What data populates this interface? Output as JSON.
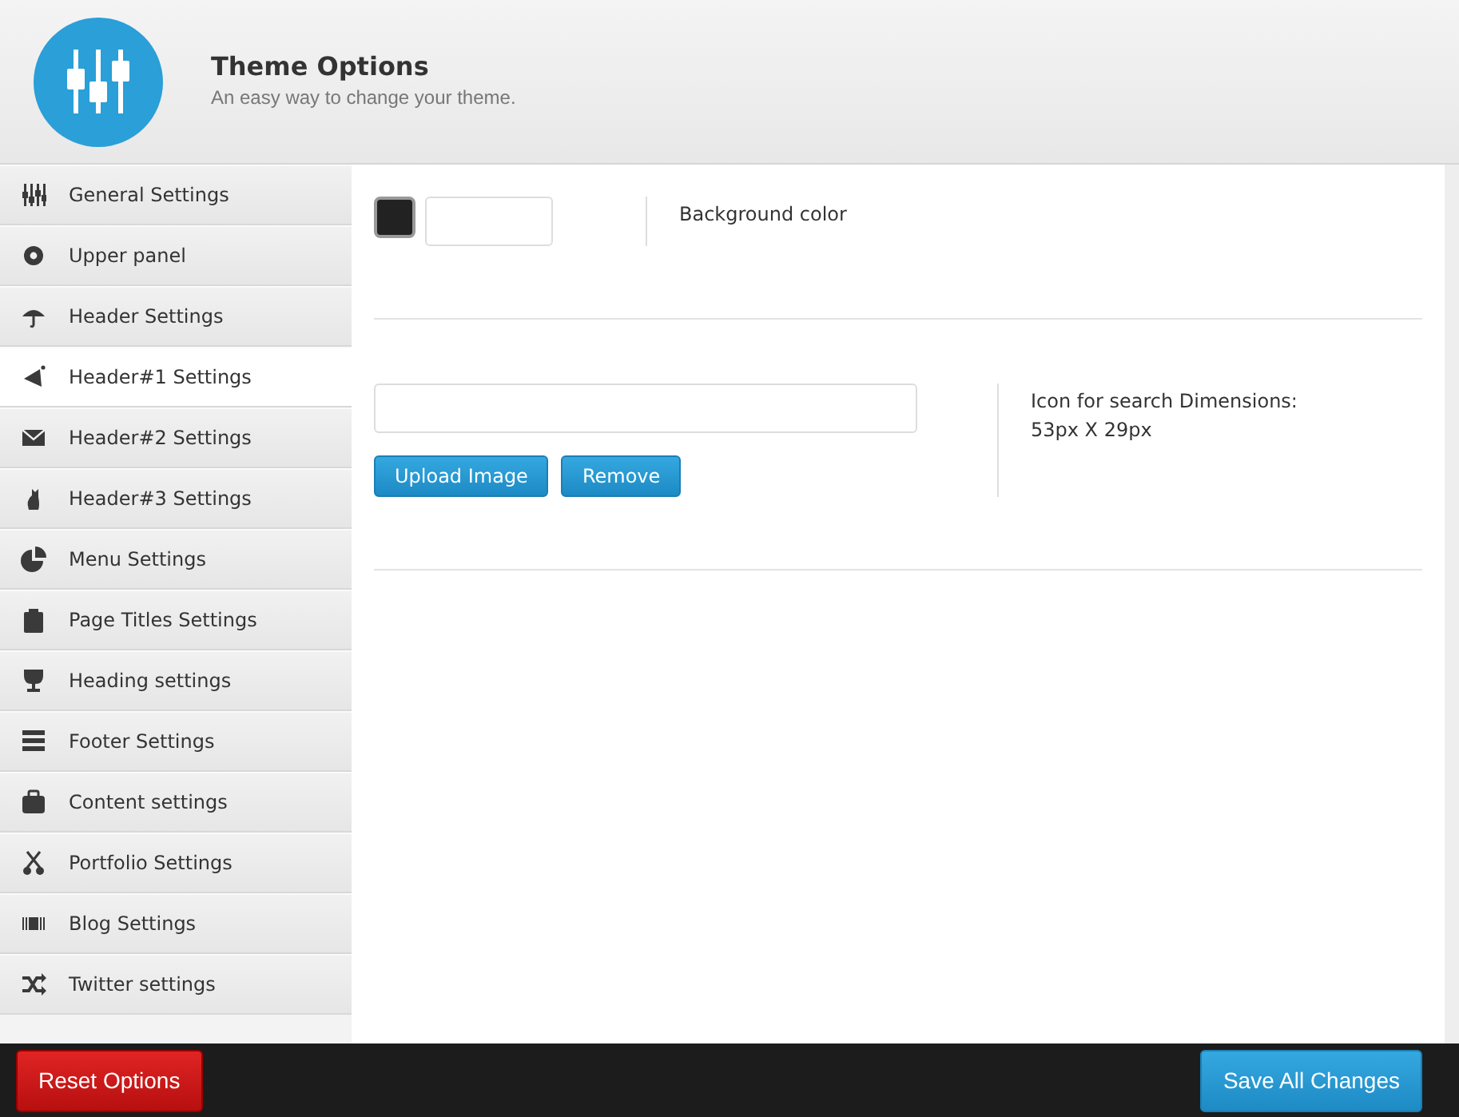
{
  "header": {
    "title": "Theme Options",
    "subtitle": "An easy way to change your theme."
  },
  "sidebar": {
    "items": [
      {
        "label": "General Settings",
        "selected": false
      },
      {
        "label": "Upper panel",
        "selected": false
      },
      {
        "label": "Header Settings",
        "selected": false
      },
      {
        "label": "Header#1 Settings",
        "selected": true
      },
      {
        "label": "Header#2 Settings",
        "selected": false
      },
      {
        "label": "Header#3 Settings",
        "selected": false
      },
      {
        "label": "Menu Settings",
        "selected": false
      },
      {
        "label": "Page Titles Settings",
        "selected": false
      },
      {
        "label": "Heading settings",
        "selected": false
      },
      {
        "label": "Footer Settings",
        "selected": false
      },
      {
        "label": "Content settings",
        "selected": false
      },
      {
        "label": "Portfolio Settings",
        "selected": false
      },
      {
        "label": "Blog Settings",
        "selected": false
      },
      {
        "label": "Twitter settings",
        "selected": false
      }
    ]
  },
  "options": [
    {
      "kind": "color",
      "description": "Background color"
    },
    {
      "kind": "upload",
      "description": "Icon for search Dimensions: 53px X 29px",
      "buttons": [
        "Upload Image",
        "Remove"
      ]
    }
  ],
  "footer": {
    "reset_button": "Reset Options",
    "save_button": "Save All Changes"
  }
}
